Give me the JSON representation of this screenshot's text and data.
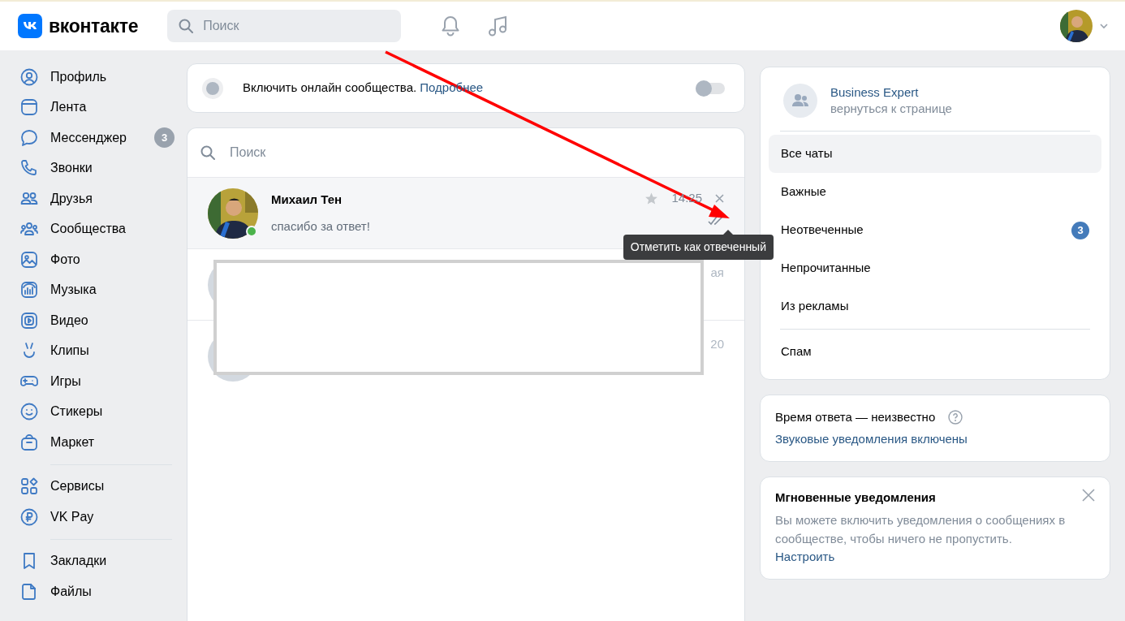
{
  "header": {
    "logo_text": "вконтакте",
    "search": {
      "placeholder": "Поиск"
    }
  },
  "sidebar": {
    "groups": [
      {
        "items": [
          {
            "label": "Профиль"
          },
          {
            "label": "Лента"
          },
          {
            "label": "Мессенджер",
            "badge": "3"
          },
          {
            "label": "Звонки"
          },
          {
            "label": "Друзья"
          },
          {
            "label": "Сообщества"
          },
          {
            "label": "Фото"
          },
          {
            "label": "Музыка"
          },
          {
            "label": "Видео"
          },
          {
            "label": "Клипы"
          },
          {
            "label": "Игры"
          },
          {
            "label": "Стикеры"
          },
          {
            "label": "Маркет"
          }
        ]
      },
      {
        "items": [
          {
            "label": "Сервисы"
          },
          {
            "label": "VK Pay"
          }
        ]
      },
      {
        "items": [
          {
            "label": "Закладки"
          },
          {
            "label": "Файлы"
          }
        ]
      }
    ]
  },
  "online_toggle": {
    "label": "Включить онлайн сообщества.",
    "link": "Подробнее",
    "on": false
  },
  "chat_list": {
    "search": {
      "placeholder": "Поиск"
    },
    "chats": [
      {
        "name": "Михаил Тен",
        "preview": "спасибо за ответ!",
        "time": "14:25",
        "online": true,
        "hovered": true,
        "tooltip": "Отметить как отвеченный"
      }
    ],
    "hidden_rows": [
      {
        "visible_text": "ая"
      },
      {
        "visible_text": "20"
      }
    ]
  },
  "community": {
    "name": "Business Expert",
    "subtitle": "вернуться к странице"
  },
  "folder_groups": [
    [
      {
        "label": "Все чаты",
        "selected": true
      },
      {
        "label": "Важные",
        "selected": false
      },
      {
        "label": "Неотвеченные",
        "badge": "3",
        "selected": false
      },
      {
        "label": "Непрочитанные",
        "selected": false
      },
      {
        "label": "Из рекламы",
        "selected": false
      }
    ],
    [
      {
        "label": "Спам",
        "selected": false
      }
    ]
  ],
  "response_card": {
    "response_time": "Время ответа — неизвестно",
    "sound_link": "Звуковые уведомления включены"
  },
  "notify_card": {
    "title": "Мгновенные уведомления",
    "text": "Вы можете включить уведомления о сообщениях в сообществе, чтобы ничего не пропустить.",
    "link": "Настроить"
  }
}
